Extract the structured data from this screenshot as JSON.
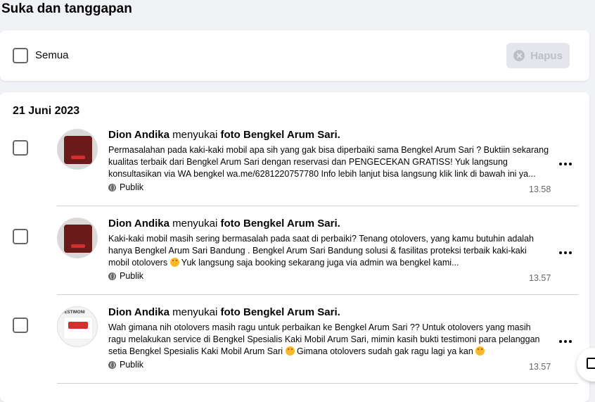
{
  "page": {
    "title": "Suka dan tanggapan"
  },
  "toolbar": {
    "select_all_label": "Semua",
    "delete_label": "Hapus"
  },
  "group": {
    "date": "21 Juni 2023"
  },
  "entries": [
    {
      "actor": "Dion Andika",
      "verb": "menyukai",
      "object": "foto Bengkel Arum Sari.",
      "snippet": "Permasalahan pada kaki-kaki mobil apa sih yang gak bisa diperbaiki sama Bengkel Arum Sari ? Buktiin sekarang kualitas terbaik dari Bengkel Arum Sari dengan reservasi dan PENGECEKAN GRATISS! Yuk langsung konsultasikan via WA bengkel wa.me/6281220757780 Info lebih lanjut bisa langsung klik link di bawah ini ya...",
      "audience": "Publik",
      "time": "13.58"
    },
    {
      "actor": "Dion Andika",
      "verb": "menyukai",
      "object": "foto Bengkel Arum Sari.",
      "snippet_a": "Kaki-kaki mobil masih sering bermasalah pada saat di perbaiki? Tenang otolovers, yang kamu butuhin adalah hanya Bengkel Arum Sari Bandung . Bengkel Arum Sari Bandung solusi & fasilitas proteksi terbaik kaki-kaki mobil otolovers ",
      "snippet_b": " Yuk langsung saja booking sekarang juga via admin wa bengkel kami...",
      "audience": "Publik",
      "time": "13.57"
    },
    {
      "actor": "Dion Andika",
      "verb": "menyukai",
      "object": "foto Bengkel Arum Sari.",
      "thumb_badge": "TESTIMONI",
      "snippet_a": "Wah gimana nih otolovers masih ragu untuk perbaikan ke Bengkel Arum Sari ?? Untuk otolovers yang masih ragu melakukan service di Bengkel Spesialis Kaki Mobil Arum Sari, mimin kasih bukti testimoni para pelanggan setia Bengkel Spesialis Kaki Mobil Arum Sari ",
      "snippet_b": " Gimana otolovers sudah gak ragu lagi ya kan ",
      "audience": "Publik",
      "time": "13.57"
    }
  ],
  "colors": {
    "background": "#f0f2f5",
    "card": "#ffffff",
    "secondary_text": "#65676b",
    "disabled_button": "#e4e6eb"
  }
}
